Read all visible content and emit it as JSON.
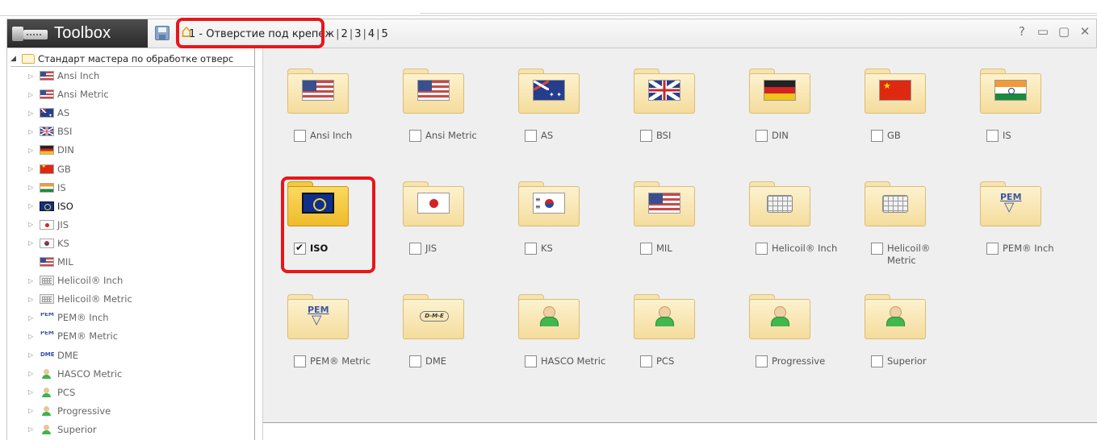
{
  "toolbar": {
    "title": "Toolbox",
    "tabs": [
      "1 - Отверстие под крепеж",
      "2",
      "3",
      "4",
      "5"
    ],
    "help_icon": "?",
    "minimize_icon": "▭",
    "restore_icon": "▢",
    "close_icon": "✕"
  },
  "tree": {
    "root_label": "Стандарт мастера по обработке отверс",
    "items": [
      {
        "label": "Ansi Inch",
        "icon": "us-flag-icon"
      },
      {
        "label": "Ansi Metric",
        "icon": "us-flag-icon"
      },
      {
        "label": "AS",
        "icon": "au-flag-icon"
      },
      {
        "label": "BSI",
        "icon": "uk-flag-icon"
      },
      {
        "label": "DIN",
        "icon": "de-flag-icon"
      },
      {
        "label": "GB",
        "icon": "cn-flag-icon"
      },
      {
        "label": "IS",
        "icon": "in-flag-icon"
      },
      {
        "label": "ISO",
        "icon": "iso-icon"
      },
      {
        "label": "JIS",
        "icon": "jp-flag-icon"
      },
      {
        "label": "KS",
        "icon": "kr-flag-icon"
      },
      {
        "label": "MIL",
        "icon": "us-flag-icon"
      },
      {
        "label": "Helicoil® Inch",
        "icon": "helicoil-icon"
      },
      {
        "label": "Helicoil® Metric",
        "icon": "helicoil-icon"
      },
      {
        "label": "PEM® Inch",
        "icon": "pem-icon"
      },
      {
        "label": "PEM® Metric",
        "icon": "pem-icon"
      },
      {
        "label": "DME",
        "icon": "dme-icon"
      },
      {
        "label": "HASCO Metric",
        "icon": "person-icon"
      },
      {
        "label": "PCS",
        "icon": "person-icon"
      },
      {
        "label": "Progressive",
        "icon": "person-icon"
      },
      {
        "label": "Superior",
        "icon": "person-icon"
      }
    ]
  },
  "tiles": [
    {
      "label": "Ansi Inch",
      "checked": false
    },
    {
      "label": "Ansi Metric",
      "checked": false
    },
    {
      "label": "AS",
      "checked": false
    },
    {
      "label": "BSI",
      "checked": false
    },
    {
      "label": "DIN",
      "checked": false
    },
    {
      "label": "GB",
      "checked": false
    },
    {
      "label": "IS",
      "checked": false
    },
    {
      "label": "ISO",
      "checked": true
    },
    {
      "label": "JIS",
      "checked": false
    },
    {
      "label": "KS",
      "checked": false
    },
    {
      "label": "MIL",
      "checked": false
    },
    {
      "label": "Helicoil® Inch",
      "checked": false
    },
    {
      "label": "Helicoil® Metric",
      "checked": false
    },
    {
      "label": "PEM® Inch",
      "checked": false
    },
    {
      "label": "PEM® Metric",
      "checked": false
    },
    {
      "label": "DME",
      "checked": false
    },
    {
      "label": "HASCO Metric",
      "checked": false
    },
    {
      "label": "PCS",
      "checked": false
    },
    {
      "label": "Progressive",
      "checked": false
    },
    {
      "label": "Superior",
      "checked": false
    }
  ],
  "colors": {
    "highlight_red": "#e8151b",
    "toolbar_dark": "#2b2b2b",
    "folder_yellow": "#f4dc9c"
  }
}
